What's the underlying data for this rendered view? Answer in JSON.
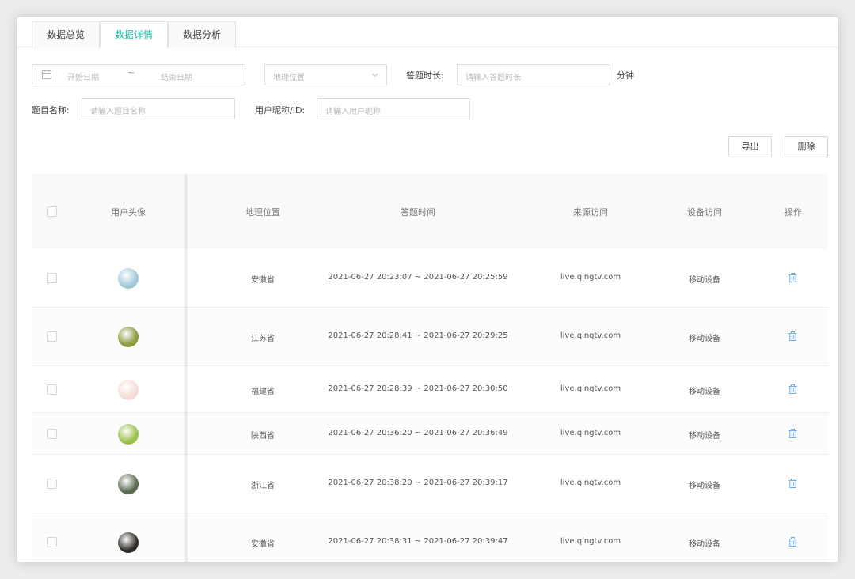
{
  "tabs": [
    {
      "label": "数据总览",
      "active": false
    },
    {
      "label": "数据详情",
      "active": true
    },
    {
      "label": "数据分析",
      "active": false
    }
  ],
  "filters": {
    "start_date_placeholder": "开始日期",
    "range_separator": "~",
    "end_date_placeholder": "结束日期",
    "location_placeholder": "地理位置",
    "duration_label": "答题时长:",
    "duration_placeholder": "请输入答题时长",
    "duration_unit": "分钟",
    "title_label": "题目名称:",
    "title_placeholder": "请输入题目名称",
    "user_label": "用户昵称/ID:",
    "user_placeholder": "请输入用户昵称"
  },
  "actions": {
    "export_label": "导出",
    "delete_label": "删除"
  },
  "table": {
    "columns": [
      "用户头像",
      "地理位置",
      "答题时间",
      "来源访问",
      "设备访问",
      "操作"
    ],
    "rows": [
      {
        "location": "安徽省",
        "time": "2021-06-27 20:23:07 ~ 2021-06-27 20:25:59",
        "source": "live.qingtv.com",
        "device": "移动设备",
        "avatar_color": "#9fc9d8"
      },
      {
        "location": "江苏省",
        "time": "2021-06-27 20:28:41 ~ 2021-06-27 20:29:25",
        "source": "live.qingtv.com",
        "device": "移动设备",
        "avatar_color": "#8d9a3c"
      },
      {
        "location": "福建省",
        "time": "2021-06-27 20:28:39 ~ 2021-06-27 20:30:50",
        "source": "live.qingtv.com",
        "device": "移动设备",
        "avatar_color": "#f3dcd3"
      },
      {
        "location": "陕西省",
        "time": "2021-06-27 20:36:20 ~ 2021-06-27 20:36:49",
        "source": "live.qingtv.com",
        "device": "移动设备",
        "avatar_color": "#9bc04a"
      },
      {
        "location": "浙江省",
        "time": "2021-06-27 20:38:20 ~ 2021-06-27 20:39:17",
        "source": "live.qingtv.com",
        "device": "移动设备",
        "avatar_color": "#5b6a52"
      },
      {
        "location": "安徽省",
        "time": "2021-06-27 20:38:31 ~ 2021-06-27 20:39:47",
        "source": "live.qingtv.com",
        "device": "移动设备",
        "avatar_color": "#2f2b26"
      }
    ]
  },
  "colors": {
    "accent": "#1fb7a6",
    "trash_icon": "#6aaee6"
  }
}
